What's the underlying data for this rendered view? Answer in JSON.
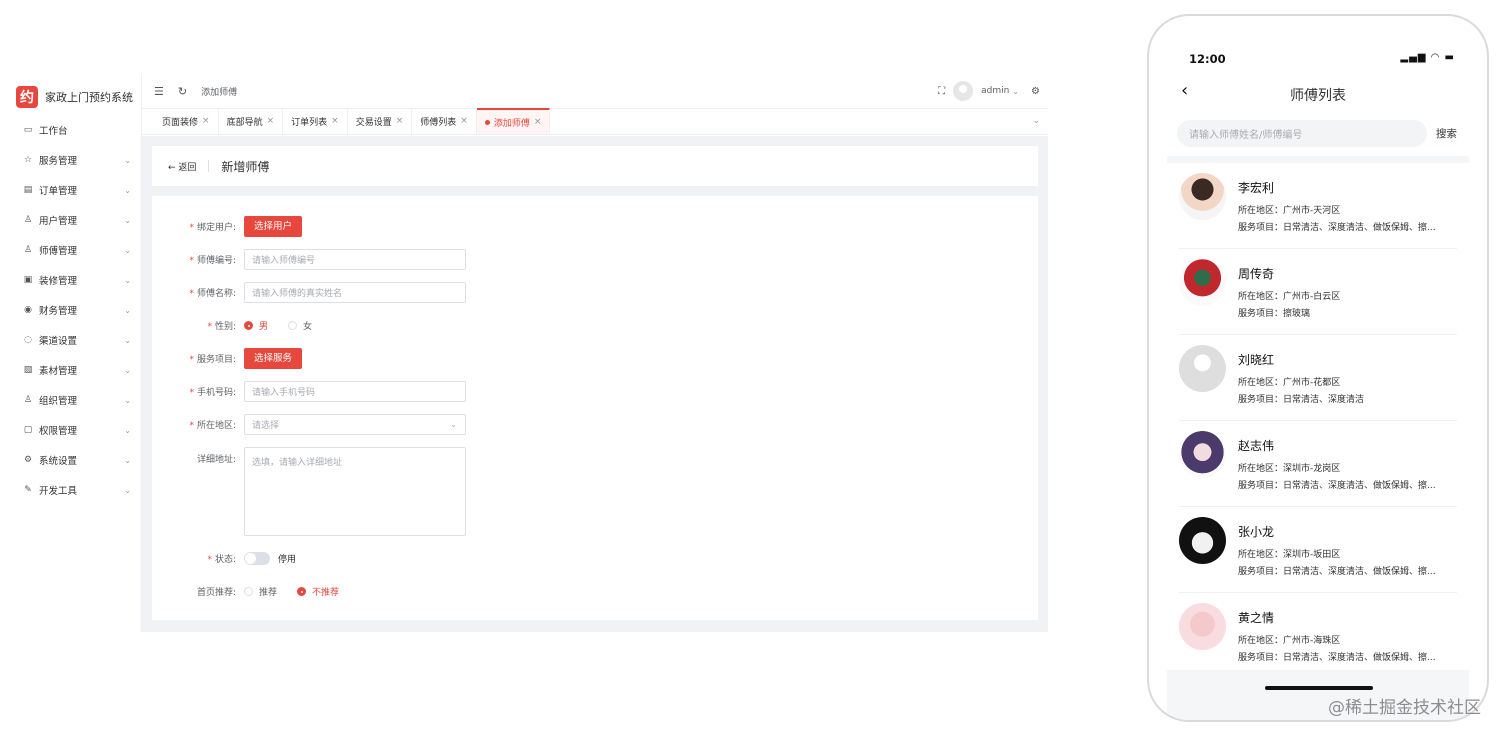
{
  "admin": {
    "logo_glyph": "约",
    "app_title": "家政上门预约系统",
    "menu": [
      {
        "label": "工作台",
        "icon": "monitor-icon",
        "has_children": false
      },
      {
        "label": "服务管理",
        "icon": "star-icon",
        "has_children": true
      },
      {
        "label": "订单管理",
        "icon": "document-icon",
        "has_children": true
      },
      {
        "label": "用户管理",
        "icon": "user-icon",
        "has_children": true
      },
      {
        "label": "师傅管理",
        "icon": "worker-icon",
        "has_children": true
      },
      {
        "label": "装修管理",
        "icon": "box-icon",
        "has_children": true
      },
      {
        "label": "财务管理",
        "icon": "money-icon",
        "has_children": true
      },
      {
        "label": "渠道设置",
        "icon": "chat-icon",
        "has_children": true
      },
      {
        "label": "素材管理",
        "icon": "image-icon",
        "has_children": true
      },
      {
        "label": "组织管理",
        "icon": "user-icon",
        "has_children": true
      },
      {
        "label": "权限管理",
        "icon": "lock-icon",
        "has_children": true
      },
      {
        "label": "系统设置",
        "icon": "gear-icon",
        "has_children": true
      },
      {
        "label": "开发工具",
        "icon": "tool-icon",
        "has_children": true
      }
    ],
    "breadcrumb": "添加师傅",
    "username": "admin",
    "tabs": [
      {
        "label": "页面装修",
        "active": false
      },
      {
        "label": "底部导航",
        "active": false
      },
      {
        "label": "订单列表",
        "active": false
      },
      {
        "label": "交易设置",
        "active": false
      },
      {
        "label": "师傅列表",
        "active": false
      },
      {
        "label": "添加师傅",
        "active": true
      }
    ],
    "back_label": "返回",
    "page_title": "新增师傅",
    "form": {
      "bind_user_label": "绑定用户:",
      "bind_user_button": "选择用户",
      "worker_no_label": "师傅编号:",
      "worker_no_placeholder": "请输入师傅编号",
      "worker_name_label": "师傅名称:",
      "worker_name_placeholder": "请输入师傅的真实姓名",
      "gender_label": "性别:",
      "gender_options": [
        "男",
        "女"
      ],
      "gender_selected": "男",
      "service_label": "服务项目:",
      "service_button": "选择服务",
      "phone_label": "手机号码:",
      "phone_placeholder": "请输入手机号码",
      "region_label": "所在地区:",
      "region_placeholder": "请选择",
      "address_label": "详细地址:",
      "address_placeholder": "选填，请输入详细地址",
      "status_label": "状态:",
      "status_value": "停用",
      "recommend_label": "首页推荐:",
      "recommend_options": [
        "推荐",
        "不推荐"
      ],
      "recommend_selected": "不推荐"
    },
    "accent_color": "#e7473c"
  },
  "phone": {
    "time": "12:00",
    "title": "师傅列表",
    "search_placeholder": "请输入师傅姓名/师傅编号",
    "search_button": "搜索",
    "workers": [
      {
        "name": "李宏利",
        "region": "所在地区：广州市-天河区",
        "services": "服务项目：日常清洁、深度清洁、做饭保姆、擦..."
      },
      {
        "name": "周传奇",
        "region": "所在地区：广州市-白云区",
        "services": "服务项目：擦玻璃"
      },
      {
        "name": "刘晓红",
        "region": "所在地区：广州市-花都区",
        "services": "服务项目：日常清洁、深度清洁"
      },
      {
        "name": "赵志伟",
        "region": "所在地区：深圳市-龙岗区",
        "services": "服务项目：日常清洁、深度清洁、做饭保姆、擦..."
      },
      {
        "name": "张小龙",
        "region": "所在地区：深圳市-坂田区",
        "services": "服务项目：日常清洁、深度清洁、做饭保姆、擦..."
      },
      {
        "name": "黄之情",
        "region": "所在地区：广州市-海珠区",
        "services": "服务项目：日常清洁、深度清洁、做饭保姆、擦..."
      }
    ]
  },
  "watermark": "@稀土掘金技术社区"
}
